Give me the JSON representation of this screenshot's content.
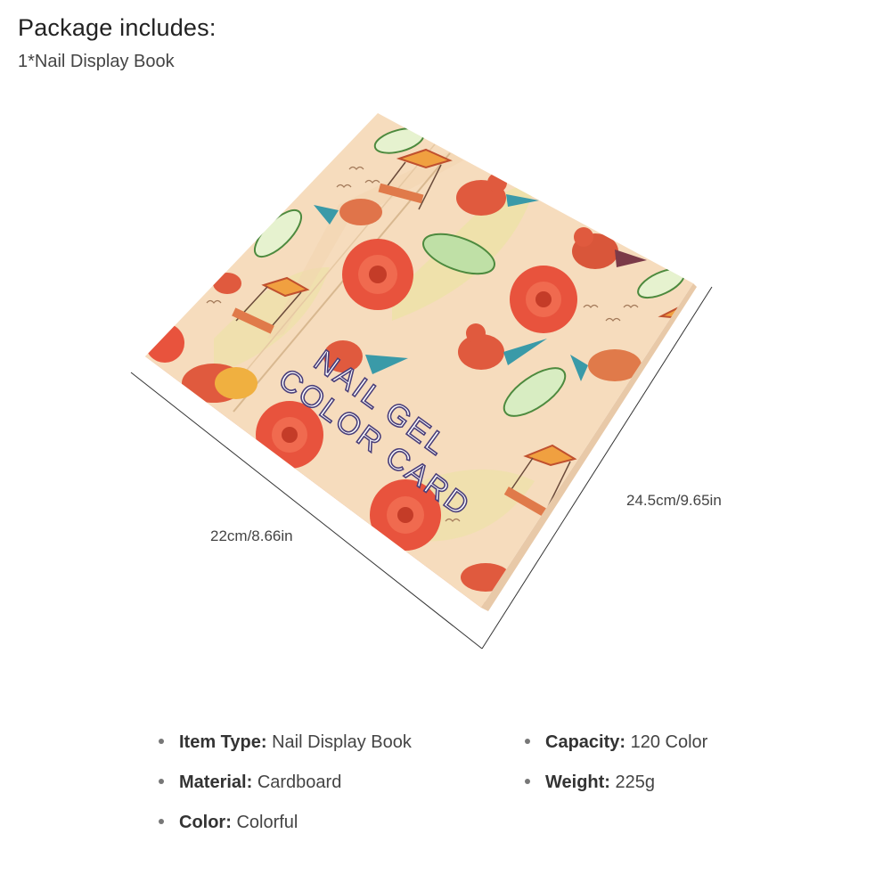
{
  "package": {
    "title": "Package includes:",
    "item": "1*Nail Display Book"
  },
  "product": {
    "cover_text": [
      "NAIL GEL",
      "COLOR CARD"
    ],
    "colors": {
      "cover": "#f5d9b4",
      "flower": "#e8533d",
      "leaf": "#6aa84f",
      "teal": "#3a9aa8",
      "text_purple": "#4a3f7a"
    }
  },
  "dimensions": {
    "width": "22cm/8.66in",
    "height": "24.5cm/9.65in"
  },
  "specs": [
    {
      "key": "Item Type:",
      "value": "Nail Display Book"
    },
    {
      "key": "Material:",
      "value": "Cardboard"
    },
    {
      "key": "Color:",
      "value": "Colorful"
    },
    {
      "key": "Capacity:",
      "value": "120 Color"
    },
    {
      "key": "Weight:",
      "value": "225g"
    }
  ]
}
